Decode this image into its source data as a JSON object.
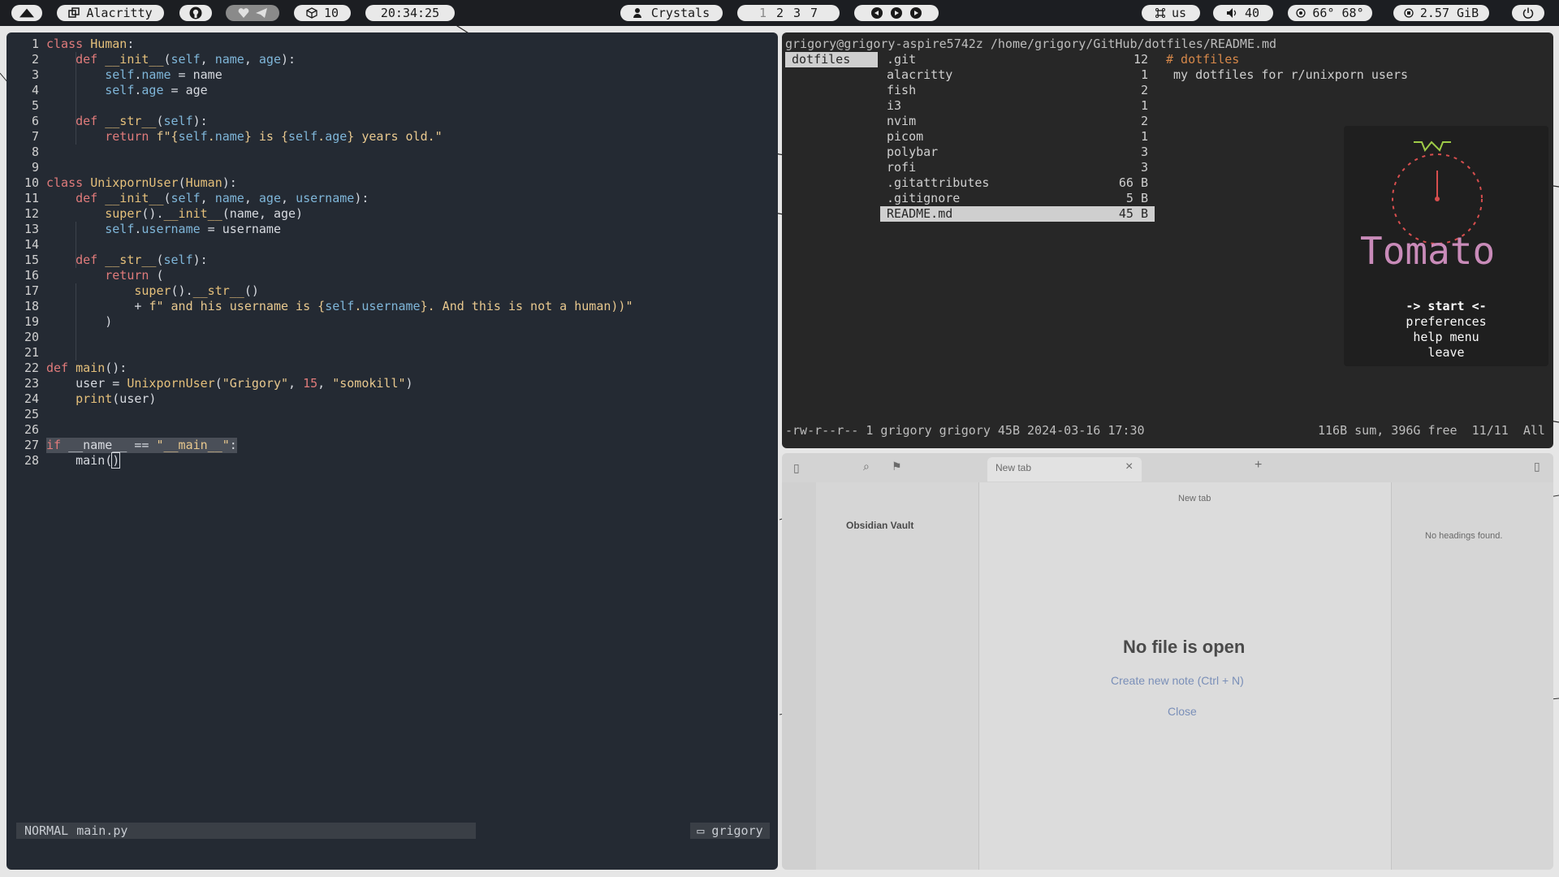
{
  "topbar": {
    "window_name": "Alacritty",
    "cube_count": "10",
    "clock": "20:34:25",
    "music": "Crystals",
    "workspaces": [
      "1",
      "2",
      "3",
      "7"
    ],
    "keyboard": "us",
    "volume": "40",
    "temps": "66° 68°",
    "memory": "2.57 GiB"
  },
  "editor": {
    "lines": [
      "class Human:",
      "    def __init__(self, name, age):",
      "        self.name = name",
      "        self.age = age",
      "",
      "    def __str__(self):",
      "        return f\"{self.name} is {self.age} years old.\"",
      "",
      "",
      "class UnixpornUser(Human):",
      "    def __init__(self, name, age, username):",
      "        super().__init__(name, age)",
      "        self.username = username",
      "",
      "    def __str__(self):",
      "        return (",
      "            super().__str__()",
      "            + f\" and his username is {self.username}. And this is not a human))\"",
      "        )",
      "",
      "",
      "def main():",
      "    user = UnixpornUser(\"Grigory\", 15, \"somokill\")",
      "    print(user)",
      "",
      "",
      "if __name__ == \"__main__\":",
      "    main()"
    ],
    "mode": "NORMAL",
    "file": "main.py",
    "cwd": "grigory"
  },
  "ranger": {
    "path": "grigory@grigory-aspire5742z /home/grigory/GitHub/dotfiles/README.md",
    "parent_dir": "dotfiles",
    "entries": [
      {
        "name": ".git",
        "size": "12"
      },
      {
        "name": "alacritty",
        "size": "1"
      },
      {
        "name": "fish",
        "size": "2"
      },
      {
        "name": "i3",
        "size": "1"
      },
      {
        "name": "nvim",
        "size": "2"
      },
      {
        "name": "picom",
        "size": "1"
      },
      {
        "name": "polybar",
        "size": "3"
      },
      {
        "name": "rofi",
        "size": "3"
      },
      {
        "name": ".gitattributes",
        "size": "66 B"
      },
      {
        "name": ".gitignore",
        "size": "5 B"
      },
      {
        "name": "README.md",
        "size": "45 B"
      }
    ],
    "preview": [
      "# dotfiles",
      " my dotfiles for r/unixporn users"
    ],
    "status_left": "-rw-r--r-- 1 grigory grigory 45B 2024-03-16 17:30",
    "status_right": "116B sum, 396G free  11/11  All"
  },
  "tomato": {
    "menu": [
      "-> start <-",
      "preferences",
      "help menu",
      "leave"
    ]
  },
  "obsidian": {
    "tab_title": "New tab",
    "header": "New tab",
    "vault": "Obsidian Vault",
    "no_headings": "No headings found.",
    "no_file": "No file is open",
    "create": "Create new note (Ctrl + N)",
    "close": "Close"
  }
}
